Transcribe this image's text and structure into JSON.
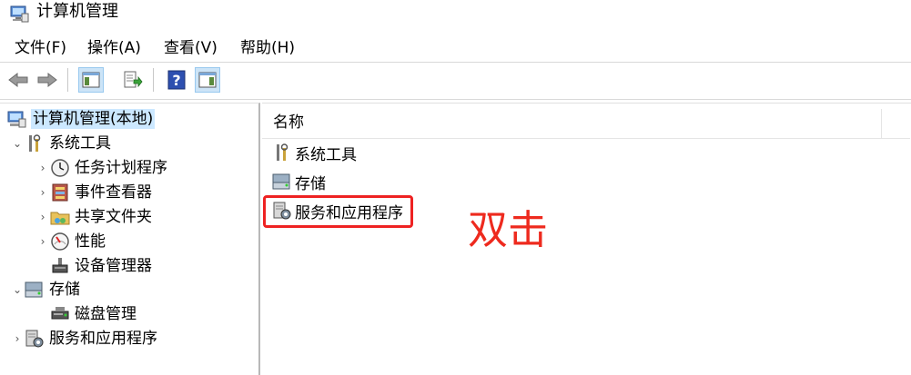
{
  "window": {
    "title": "计算机管理"
  },
  "menu": {
    "file": "文件(F)",
    "action": "操作(A)",
    "view": "查看(V)",
    "help": "帮助(H)"
  },
  "tree": {
    "root": "计算机管理(本地)",
    "system_tools": "系统工具",
    "task_scheduler": "任务计划程序",
    "event_viewer": "事件查看器",
    "shared_folders": "共享文件夹",
    "performance": "性能",
    "device_manager": "设备管理器",
    "storage": "存储",
    "disk_management": "磁盘管理",
    "services_apps": "服务和应用程序"
  },
  "content": {
    "column_name": "名称",
    "items": [
      "系统工具",
      "存储",
      "服务和应用程序"
    ]
  },
  "annotation": {
    "text": "双击",
    "color": "#ee2a1e"
  },
  "colors": {
    "selection": "#cce8ff",
    "highlight_border": "#ee2222"
  }
}
